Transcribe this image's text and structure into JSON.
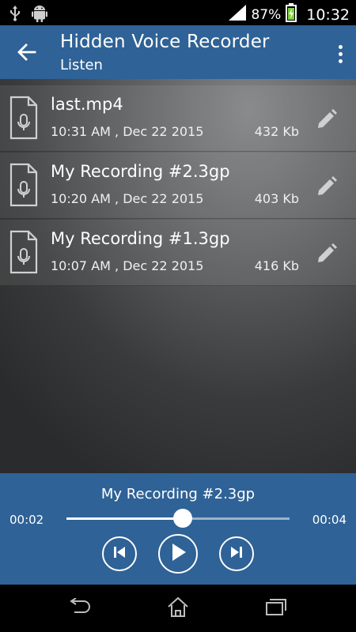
{
  "status_bar": {
    "battery_percent": "87%",
    "time": "10:32",
    "icons": [
      "usb-icon",
      "android-icon",
      "signal-icon",
      "battery-charging-icon"
    ]
  },
  "app_bar": {
    "title": "Hidden Voice Recorder",
    "subtitle": "Listen",
    "icons": [
      "back-arrow-icon",
      "overflow-menu-icon"
    ]
  },
  "recordings": [
    {
      "name": "last.mp4",
      "date": "10:31 AM , Dec 22 2015",
      "size": "432 Kb"
    },
    {
      "name": "My Recording #2.3gp",
      "date": "10:20 AM , Dec 22 2015",
      "size": "403 Kb"
    },
    {
      "name": "My Recording #1.3gp",
      "date": "10:07 AM , Dec 22 2015",
      "size": "416 Kb"
    }
  ],
  "player": {
    "now_playing": "My Recording #2.3gp",
    "current_time": "00:02",
    "total_time": "00:04",
    "progress_fraction": 0.52,
    "icons": [
      "skip-previous-icon",
      "play-icon",
      "skip-next-icon"
    ]
  },
  "colors": {
    "accent": "#2f6296",
    "status_bar": "#000000",
    "text": "#ffffff"
  }
}
